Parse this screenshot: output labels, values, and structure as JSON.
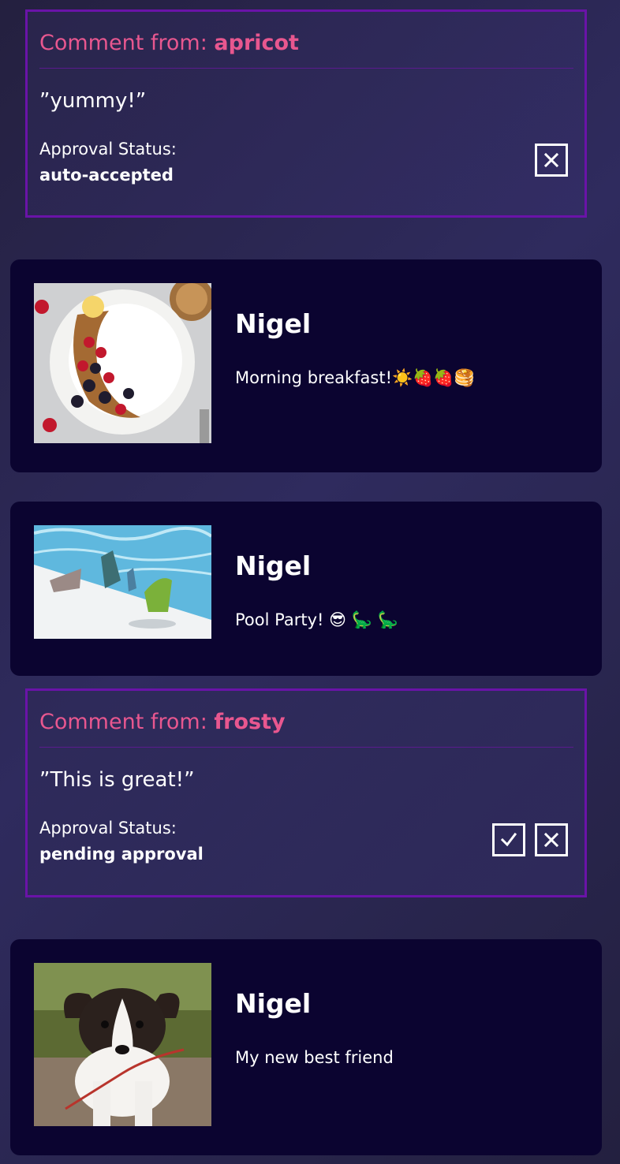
{
  "comments": [
    {
      "label": "Comment from: ",
      "username": "apricot",
      "text": "”yummy!”",
      "status_label": "Approval Status:",
      "status_value": "auto-accepted"
    },
    {
      "label": "Comment from: ",
      "username": "frosty",
      "text": "”This is great!”",
      "status_label": "Approval Status:",
      "status_value": "pending approval"
    }
  ],
  "posts": [
    {
      "author": "Nigel",
      "caption": "Morning breakfast!☀️🍓🍓🥞",
      "photo": "breakfast-bowl-photo"
    },
    {
      "author": "Nigel",
      "caption": "Pool Party! 😎 🦕 🦕",
      "photo": "pool-dinosaurs-photo"
    },
    {
      "author": "Nigel",
      "caption": "My new best friend",
      "photo": "puppy-photo"
    }
  ],
  "colors": {
    "background": "#2a2752",
    "card": "#0b0430",
    "comment_border": "#6a13a8",
    "accent_pink": "#e8578f",
    "text": "#ffffff"
  },
  "icons": [
    "close-icon",
    "check-icon"
  ]
}
